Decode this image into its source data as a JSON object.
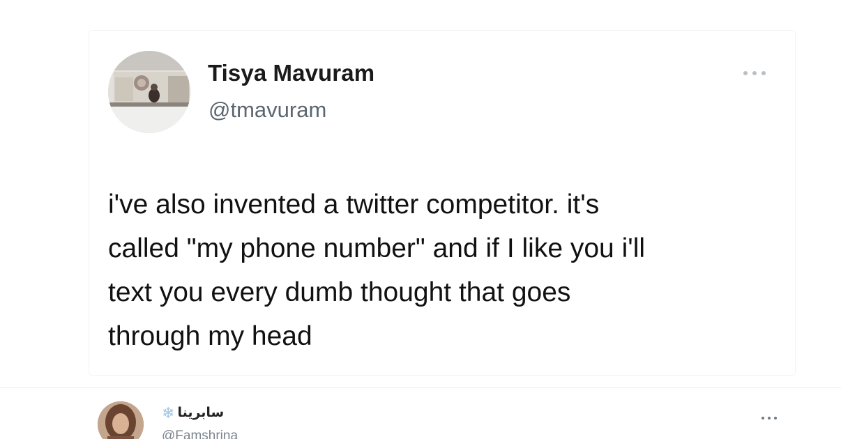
{
  "tweet": {
    "author_name": "Tisya Mavuram",
    "author_handle": "@tmavuram",
    "text": "i've also invented a twitter competitor. it's\ncalled \"my phone number\" and if I like you i'll\ntext you every dumb thought that goes\nthrough my head",
    "more_icon": "more-horizontal-icon"
  },
  "reply": {
    "author_name": "سابرينا",
    "name_icon": "snowflake-icon",
    "name_icon_glyph": "❄",
    "author_handle": "@Famshrina",
    "more_icon": "more-horizontal-icon"
  },
  "colors": {
    "name": "#1a1a1a",
    "handle": "#5b6670",
    "text": "#111111",
    "snowflake": "#9fc7ea"
  }
}
